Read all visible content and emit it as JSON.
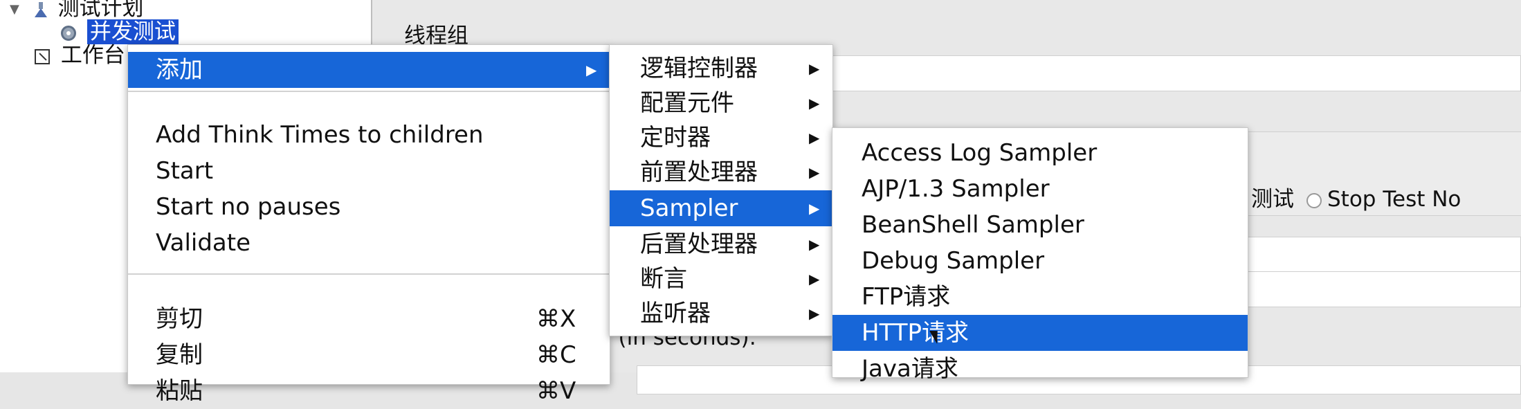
{
  "tree": {
    "root_label": "测试计划",
    "thread_group_label": "并发测试",
    "workbench_label": "工作台"
  },
  "panel": {
    "title": "线程组",
    "stop_test_partial": "测试",
    "stop_test_now_label": "Stop Test No",
    "ramp_up_partial": "d (in seconds):"
  },
  "context_menu": {
    "add": "添加",
    "add_think_times": "Add Think Times to children",
    "start": "Start",
    "start_no_pauses": "Start no pauses",
    "validate": "Validate",
    "cut": "剪切",
    "cut_shortcut": "⌘X",
    "copy": "复制",
    "copy_shortcut": "⌘C",
    "paste": "粘贴",
    "paste_shortcut": "⌘V"
  },
  "add_submenu": {
    "logic_controller": "逻辑控制器",
    "config_element": "配置元件",
    "timer": "定时器",
    "pre_processor": "前置处理器",
    "sampler": "Sampler",
    "post_processor": "后置处理器",
    "assertion": "断言",
    "listener": "监听器"
  },
  "sampler_submenu": {
    "items": [
      "Access Log Sampler",
      "AJP/1.3 Sampler",
      "BeanShell Sampler",
      "Debug Sampler",
      "FTP请求",
      "HTTP请求",
      "Java请求"
    ]
  },
  "colors": {
    "highlight": "#1766d8",
    "tree_selection": "#1a4fd1"
  }
}
